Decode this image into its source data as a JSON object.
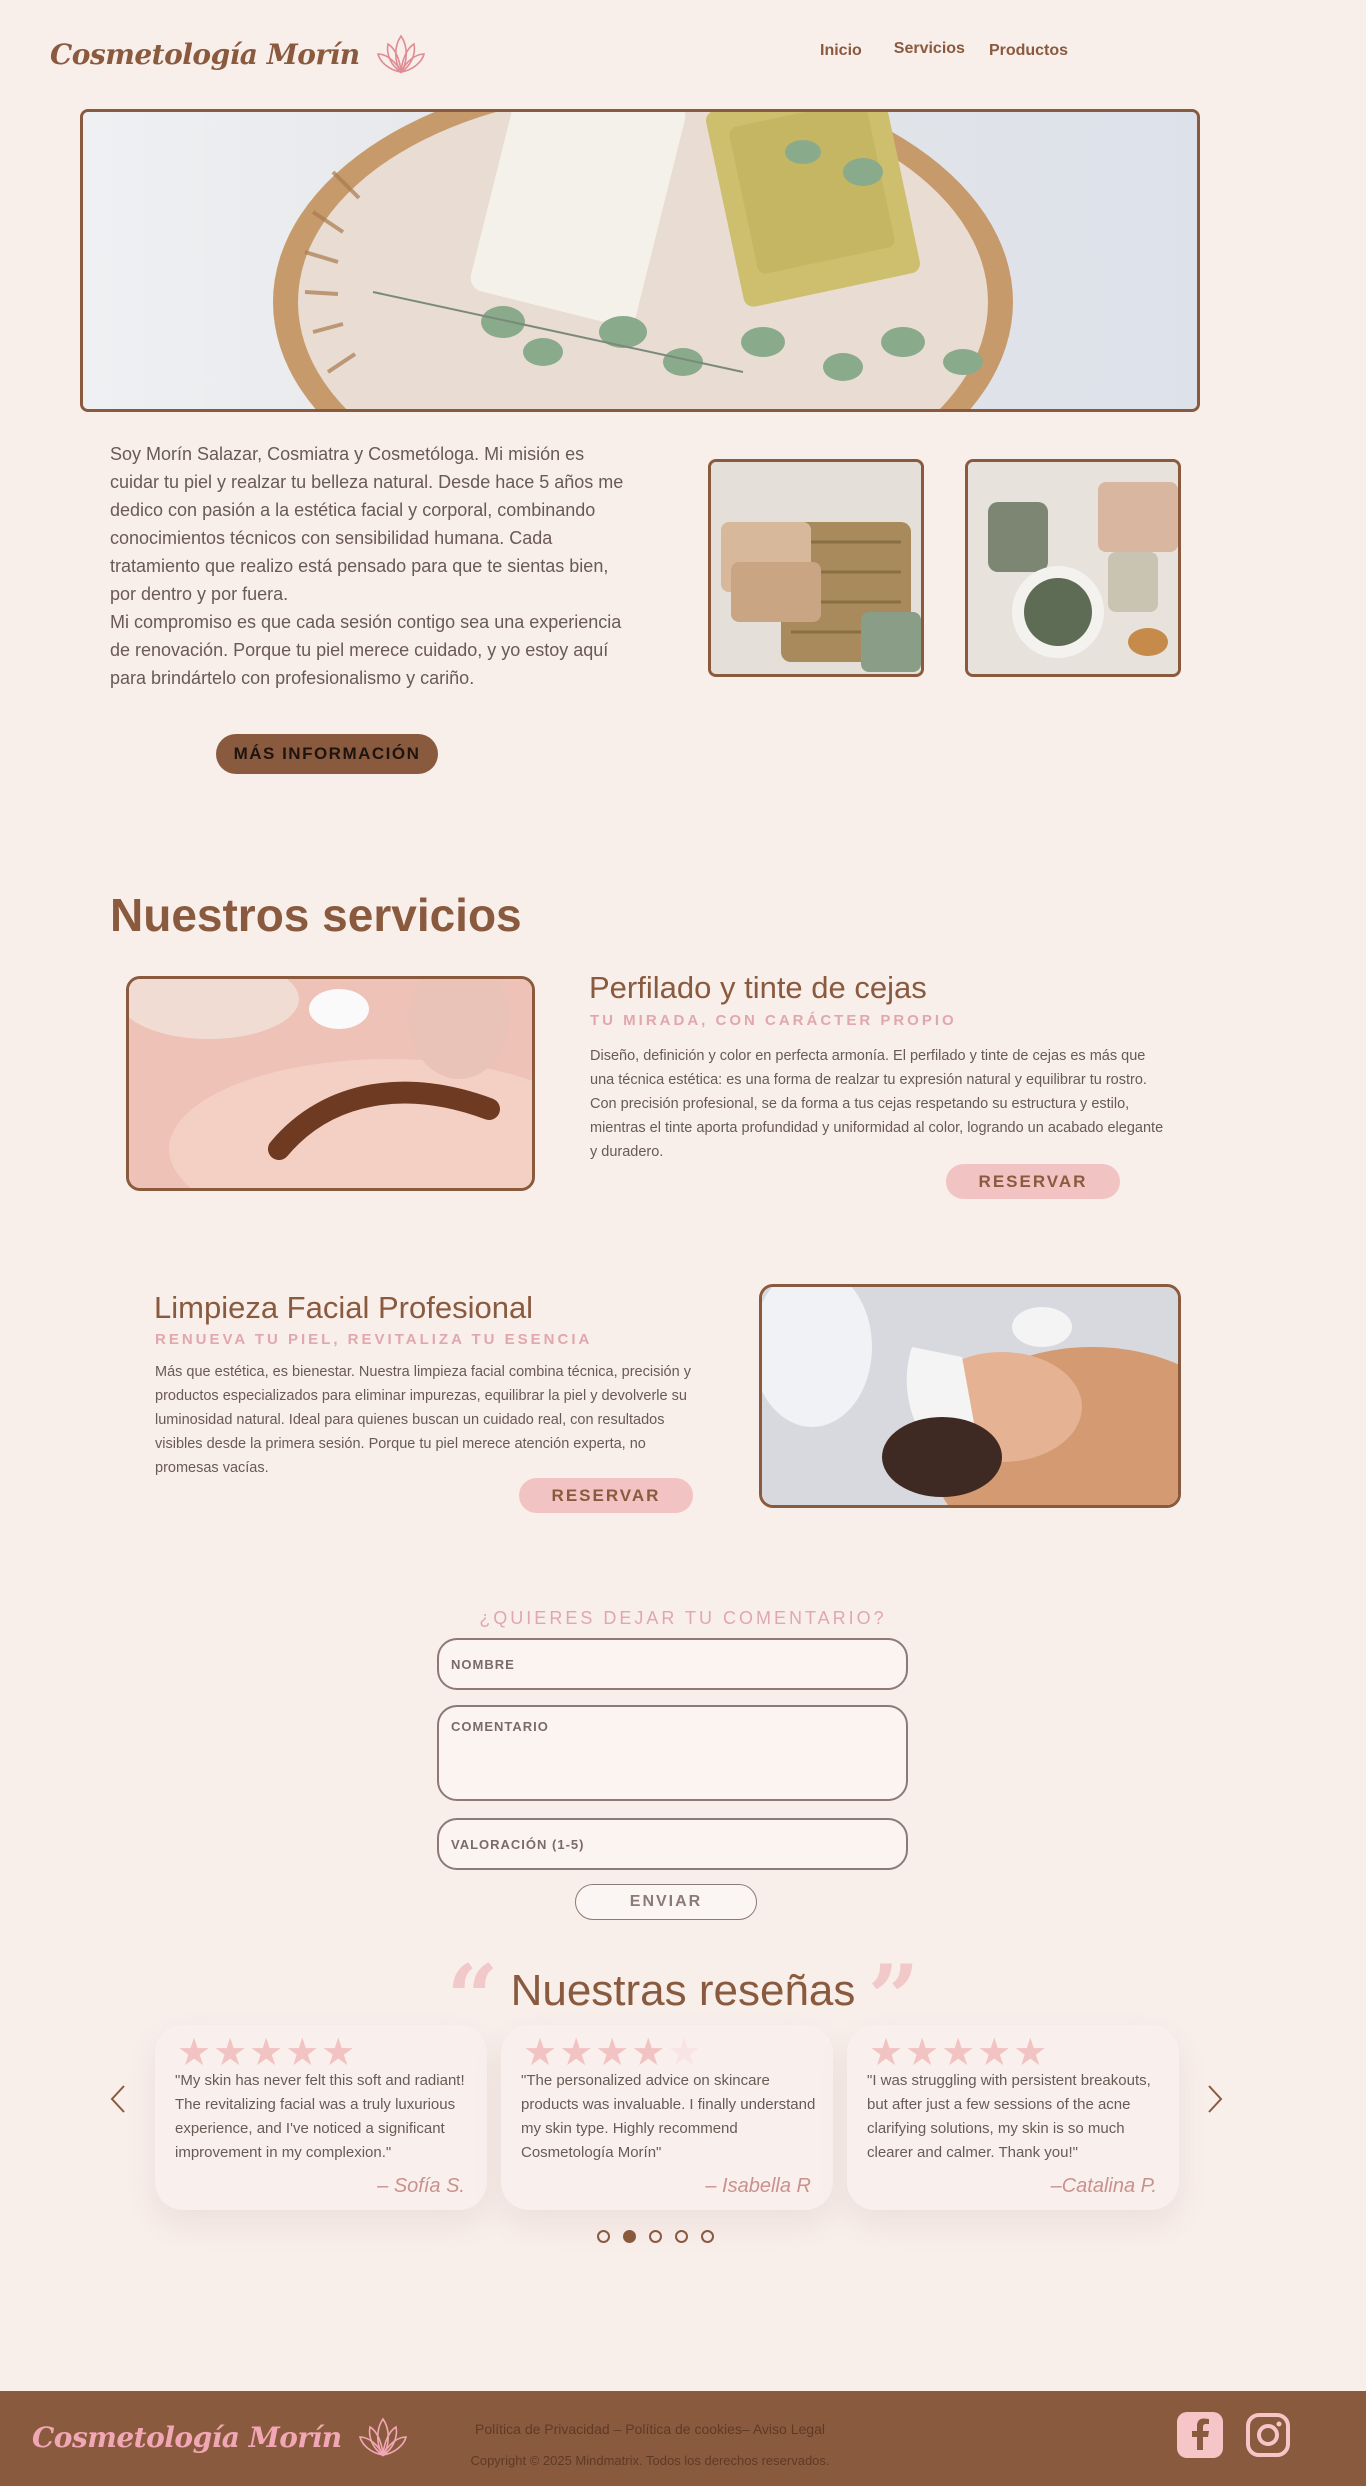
{
  "header": {
    "logo_text": "Cosmetología Morín",
    "nav": [
      "Inicio",
      "Servicios",
      "Productos"
    ]
  },
  "about": {
    "paragraph1": "Soy Morín Salazar, Cosmiatra y Cosmetóloga. Mi misión es\ncuidar tu piel y realzar tu belleza natural. Desde hace  5 años me\ndedico con pasión a la estética facial y corporal, combinando\nconocimientos técnicos con sensibilidad humana. Cada\ntratamiento que realizo está pensado para que te sientas bien,\npor dentro y por fuera.",
    "paragraph2": "Mi compromiso es que cada sesión contigo sea una experiencia\nde renovación. Porque tu piel merece cuidado, y yo estoy aquí\npara brindártelo con profesionalismo y cariño.",
    "more_button": "MÁS INFORMACIÓN"
  },
  "services": {
    "title": "Nuestros servicios",
    "items": [
      {
        "title": "Perfilado y tinte de cejas",
        "subtitle": "TU MIRADA, CON CARÁCTER PROPIO",
        "description": "Diseño, definición y color en perfecta armonía. El perfilado y tinte de cejas es más que\nuna técnica estética: es una forma de realzar tu expresión natural y equilibrar tu rostro.\nCon precisión profesional, se da forma a tus cejas respetando su estructura y estilo,\nmientras el tinte aporta profundidad y uniformidad al color, logrando un acabado elegante\ny duradero.",
        "button": "RESERVAR"
      },
      {
        "title": "Limpieza Facial Profesional",
        "subtitle": "RENUEVA TU PIEL, REVITALIZA TU ESENCIA",
        "description": "Más que estética, es bienestar. Nuestra limpieza facial combina técnica, precisión y\nproductos especializados para eliminar impurezas, equilibrar la piel y devolverle su\nluminosidad natural. Ideal para quienes buscan un cuidado real, con resultados\nvisibles desde la primera sesión. Porque tu piel merece atención experta, no\npromesas vacías.",
        "button": "RESERVAR"
      }
    ]
  },
  "comment_form": {
    "title": "¿QUIERES DEJAR TU COMENTARIO?",
    "name_placeholder": "NOMBRE",
    "comment_placeholder": "COMENTARIO",
    "rating_placeholder": "VALORACIÓN (1-5)",
    "submit": "ENVIAR"
  },
  "reviews": {
    "title": "Nuestras reseñas",
    "items": [
      {
        "rating": 5,
        "text": "\"My skin has never felt this soft and radiant! The revitalizing facial was a truly luxurious experience, and I've noticed a significant improvement in my complexion.\"",
        "author": "– Sofía S."
      },
      {
        "rating": 4,
        "text": "\"The personalized advice on skincare products was invaluable. I finally understand my skin type. Highly recommend Cosmetología Morín\"",
        "author": "– Isabella R"
      },
      {
        "rating": 5,
        "text": "\"I was struggling with persistent breakouts, but after just a few sessions of the acne clarifying solutions, my skin is so much clearer and calmer. Thank you!\"",
        "author": "–Catalina P."
      }
    ],
    "pages": 5,
    "active_page": 2
  },
  "footer": {
    "logo_text": "Cosmetología Morín",
    "links": "Política de Privacidad – Política de cookies– Aviso Legal",
    "copyright": "Copyright © 2025 Mindmatrix. Todos los derechos reservados."
  },
  "colors": {
    "background": "#f8eeea",
    "brown": "#8a5a3f",
    "pink": "#f2c3c3",
    "footer": "#8a5a3f"
  }
}
